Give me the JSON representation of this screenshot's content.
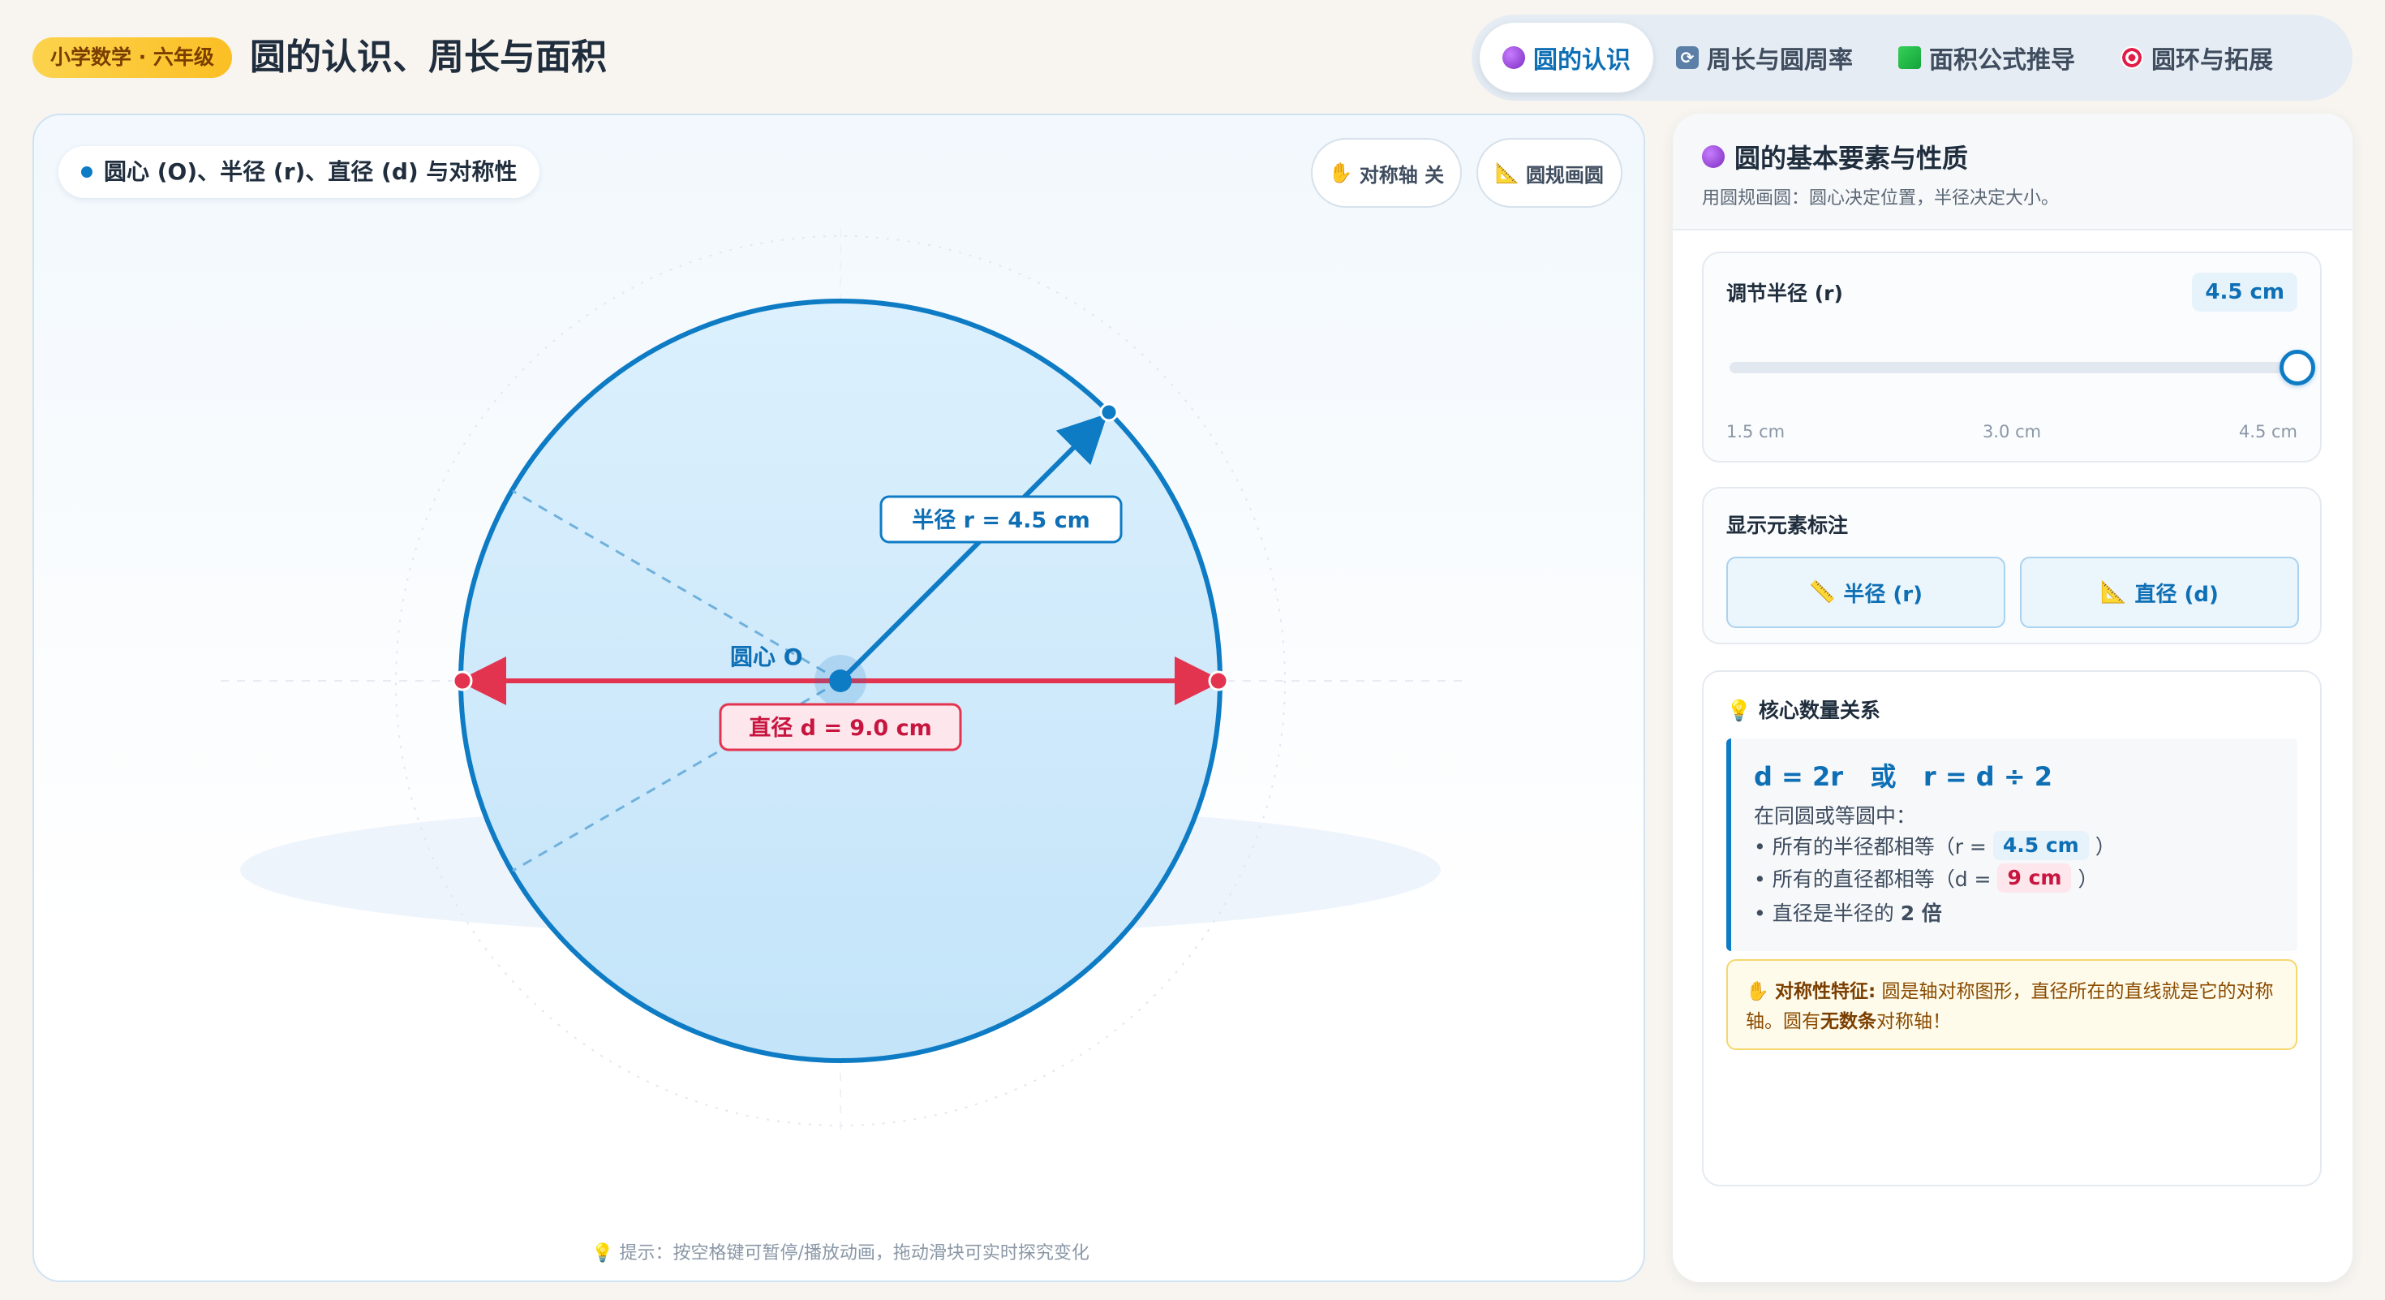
{
  "header": {
    "badge": "小学数学 · 六年级",
    "title": "圆的认识、周长与面积",
    "tabs": [
      {
        "label": "圆的认识",
        "icon": "purple-circle-icon",
        "active": true
      },
      {
        "label": "周长与圆周率",
        "icon": "cycle-icon",
        "active": false
      },
      {
        "label": "面积公式推导",
        "icon": "green-square-icon",
        "active": false
      },
      {
        "label": "圆环与拓展",
        "icon": "target-icon",
        "active": false
      }
    ]
  },
  "canvas": {
    "label": "圆心 (O)、半径 (r)、直径 (d) 与对称性",
    "symmetry_button": "对称轴 关",
    "compass_button": "圆规画圆",
    "center_label": "圆心 O",
    "radius_label": "半径 r = 4.5 cm",
    "diameter_label": "直径 d = 9.0 cm",
    "hint": "提示：按空格键可暂停/播放动画，拖动滑块可实时探究变化"
  },
  "side": {
    "title": "圆的基本要素与性质",
    "subtitle": "用圆规画圆：圆心决定位置，半径决定大小。",
    "slider": {
      "label": "调节半径 (r)",
      "value_text": "4.5 cm",
      "value": 4.5,
      "min": 1.5,
      "max": 4.5,
      "ticks": [
        "1.5 cm",
        "3.0 cm",
        "4.5 cm"
      ]
    },
    "toggles": {
      "label": "显示元素标注",
      "radius": "半径 (r)",
      "diameter": "直径 (d)"
    },
    "relation": {
      "label": "核心数量关系",
      "formula": "d = 2r   或   r = d ÷ 2",
      "intro": "在同圆或等圆中：",
      "line1_prefix": "• 所有的半径都相等（r =",
      "line1_value": "4.5 cm",
      "line1_suffix": "）",
      "line2_prefix": "• 所有的直径都相等（d =",
      "line2_value": "9 cm",
      "line2_suffix": "）",
      "line3_prefix": "• 直径是半径的",
      "line3_bold": "2 倍",
      "sym_title": "对称性特征:",
      "sym_text1": "圆是轴对称图形，直径所在的直线就是它的对称轴。圆有",
      "sym_bold": "无数条",
      "sym_text2": "对称轴！"
    }
  },
  "colors": {
    "accent": "#0e7bc5",
    "diameter": "#e3344f",
    "fill": "#cfe9fb"
  }
}
